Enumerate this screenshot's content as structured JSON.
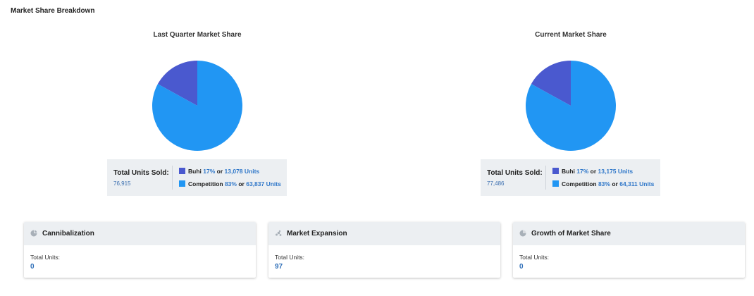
{
  "page": {
    "title": "Market Share Breakdown"
  },
  "colors": {
    "buhi": "#4a59cf",
    "competition": "#2196f3",
    "accent": "#2f77c9"
  },
  "charts": [
    {
      "title": "Last Quarter Market Share",
      "total_label": "Total Units Sold:",
      "total_value": "76,915",
      "legend": [
        {
          "name": "Buhi",
          "pct": "17%",
          "or": "or",
          "units": "13,078 Units"
        },
        {
          "name": "Competition",
          "pct": "83%",
          "or": "or",
          "units": "63,837 Units"
        }
      ]
    },
    {
      "title": "Current Market Share",
      "total_label": "Total Units Sold:",
      "total_value": "77,486",
      "legend": [
        {
          "name": "Buhi",
          "pct": "17%",
          "or": "or",
          "units": "13,175 Units"
        },
        {
          "name": "Competition",
          "pct": "83%",
          "or": "or",
          "units": "64,311 Units"
        }
      ]
    }
  ],
  "chart_data": [
    {
      "type": "pie",
      "title": "Last Quarter Market Share",
      "categories": [
        "Buhi",
        "Competition"
      ],
      "values": [
        13078,
        63837
      ]
    },
    {
      "type": "pie",
      "title": "Current Market Share",
      "categories": [
        "Buhi",
        "Competition"
      ],
      "values": [
        13175,
        64311
      ]
    }
  ],
  "cards": [
    {
      "title": "Cannibalization",
      "icon": "pie-chart-icon",
      "label": "Total Units:",
      "value": "0"
    },
    {
      "title": "Market Expansion",
      "icon": "scatter-chart-icon",
      "label": "Total Units:",
      "value": "97"
    },
    {
      "title": "Growth of Market Share",
      "icon": "pie-chart-icon",
      "label": "Total Units:",
      "value": "0"
    }
  ]
}
